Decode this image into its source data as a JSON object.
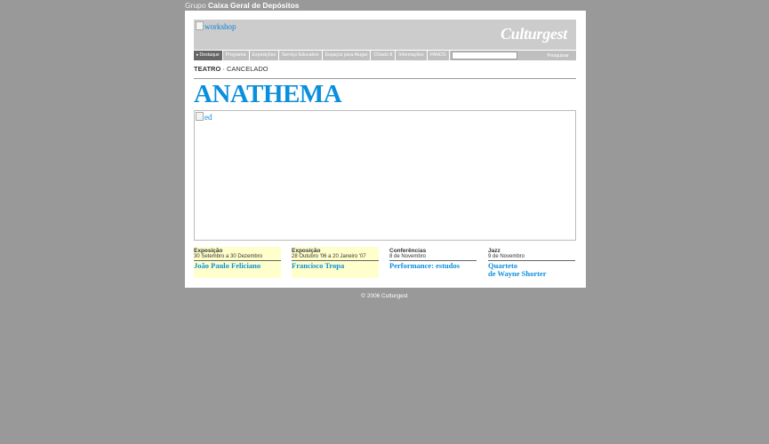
{
  "top_bar": {
    "prefix": "Grupo",
    "company": "Caixa Geral de Depósitos"
  },
  "header": {
    "banner_alt": "workshop",
    "logo_text": "Culturgest"
  },
  "nav": {
    "items": [
      "Destaque",
      "Programa",
      "Exposições",
      "Serviço Educativo",
      "Espaços para Alugar",
      "Chiado 8",
      "Informações",
      "PANOS"
    ],
    "active_index": 0,
    "search_placeholder": "",
    "search_button": "Pesquisar"
  },
  "event": {
    "category": "TEATRO",
    "separator": " · ",
    "status": "CANCELADO",
    "title": "ANATHEMA",
    "image_alt": "ed"
  },
  "teasers": [
    {
      "category": "Exposição",
      "date": "30 Setembro a 30 Dezembro",
      "name": "João Paulo Feliciano",
      "highlight": true
    },
    {
      "category": "Exposição",
      "date": "28 Outubro '06 a 20 Janeiro '07",
      "name": "Francisco Tropa",
      "highlight": true
    },
    {
      "category": "Conferências",
      "date": "8 de Novembro",
      "name": "Performance: estudos",
      "highlight": false
    },
    {
      "category": "Jazz",
      "date": "9 de Novembro",
      "name": "Quarteto\nde Wayne Shorter",
      "highlight": false
    }
  ],
  "footer": {
    "copyright": "© 2006 Culturgest"
  }
}
